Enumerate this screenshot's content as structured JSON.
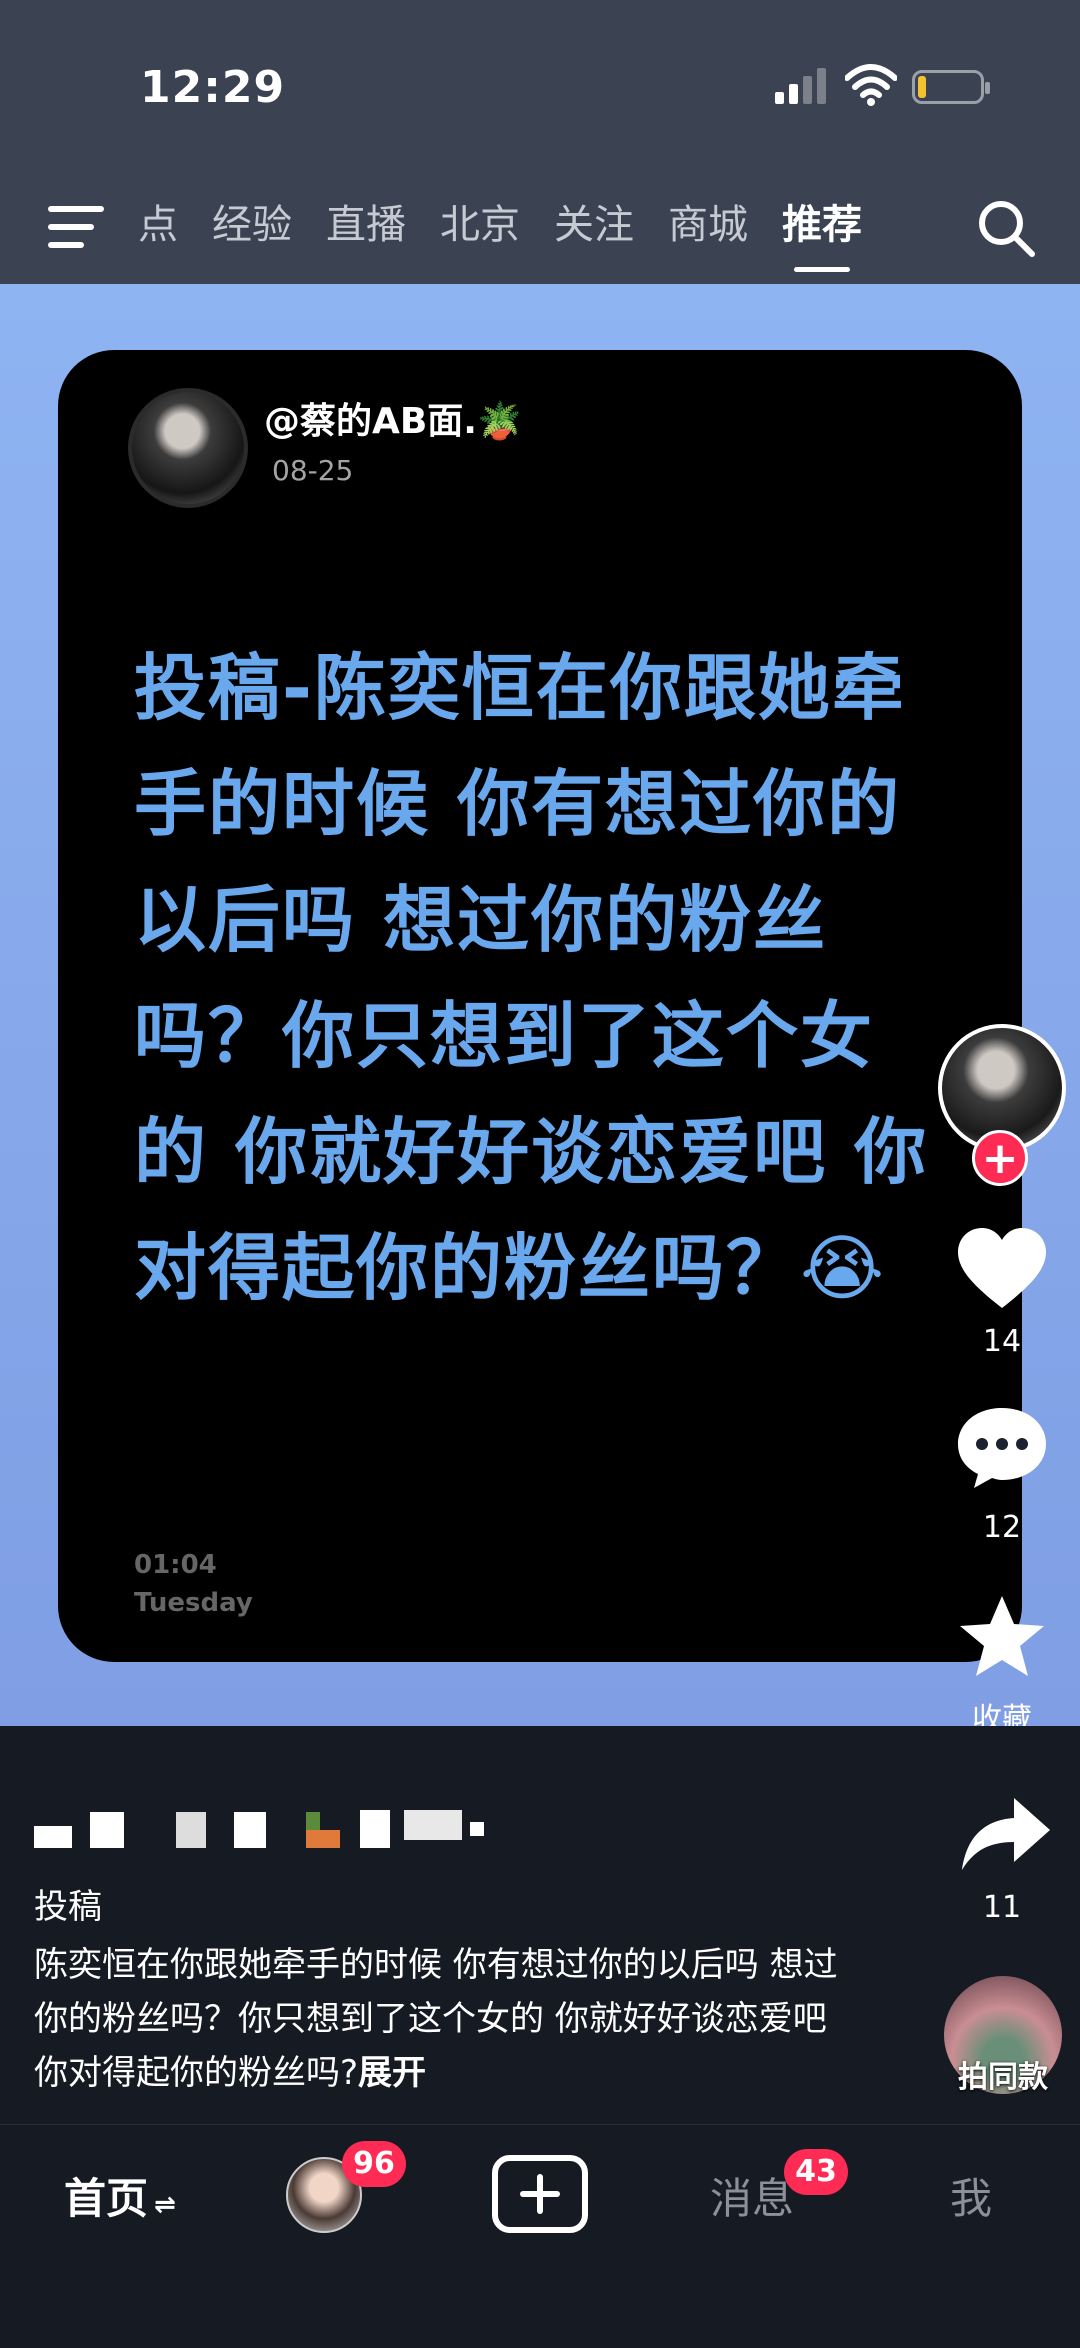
{
  "status_bar": {
    "time": "12:29"
  },
  "top_nav": {
    "tabs": [
      {
        "label": "点"
      },
      {
        "label": "经验"
      },
      {
        "label": "直播"
      },
      {
        "label": "北京"
      },
      {
        "label": "关注"
      },
      {
        "label": "商城"
      },
      {
        "label": "推荐",
        "active": true
      }
    ]
  },
  "post_card": {
    "author_name": "@蔡的AB面.🪴",
    "date": "08-25",
    "text": "投稿-陈奕恒在你跟她牵手的时候 你有想过你的以后吗 想过你的粉丝吗？你只想到了这个女的 你就好好谈恋爱吧 你对得起你的粉丝吗？😭",
    "clock_time": "01:04",
    "clock_day": "Tuesday"
  },
  "right_rail": {
    "follow_symbol": "+",
    "likes": "14",
    "comments": "12",
    "favorite_label": "收藏",
    "shares": "11",
    "same_style_label": "拍同款"
  },
  "caption": {
    "title": "投稿",
    "body": "陈奕恒在你跟她牵手的时候 你有想过你的以后吗 想过你的粉丝吗？你只想到了这个女的 你就好好谈恋爱吧 你对得起你的粉丝吗?",
    "expand": "展开"
  },
  "bottom_nav": {
    "home": "首页",
    "home_swap": "⇌",
    "friends_badge": "96",
    "messages": "消息",
    "messages_badge": "43",
    "me": "我"
  },
  "colors": {
    "accent": "#fe2c55",
    "card_text": "#6aa8ee",
    "content_bg": "#8fb4f2",
    "nav_bg": "#3b4352"
  }
}
